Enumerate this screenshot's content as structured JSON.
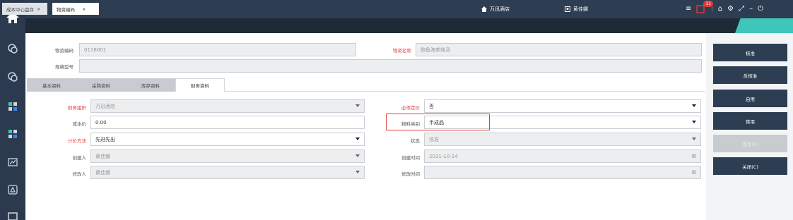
{
  "topbar": {
    "store": "万迅酒店",
    "user": "黄佳娜",
    "notification_count": "11"
  },
  "tabs": [
    {
      "label": "成本中心盘存"
    },
    {
      "label": "物资编码"
    }
  ],
  "header_fields": {
    "code_label": "物资编码",
    "code_value": "0118001",
    "name_label": "物资名称",
    "name_value": "鲍鱼海参炖汤",
    "spec_label": "规格型号",
    "spec_value": ""
  },
  "subtabs": [
    {
      "label": "基本资料"
    },
    {
      "label": "采购资料"
    },
    {
      "label": "库存资料"
    },
    {
      "label": "财务资料"
    }
  ],
  "form": {
    "org_label": "财务组织",
    "org_value": "万迅酒店",
    "cost_label": "成本价",
    "cost_value": "0.00",
    "method_label": "计价方法",
    "method_value": "先进先出",
    "creator_label": "创建人",
    "creator_value": "黄佳娜",
    "modifier_label": "修改人",
    "modifier_value": "黄佳娜",
    "must_price_label": "必须定价",
    "must_price_value": "否",
    "category_label": "物料类别",
    "category_value": "半成品",
    "status_label": "状态",
    "status_value": "核准",
    "created_time_label": "创建时间",
    "created_time_value": "2021-10-14",
    "modified_time_label": "修改时间",
    "modified_time_value": ""
  },
  "buttons": {
    "approve": "核准",
    "unapprove": "反核准",
    "enable": "启用",
    "disable": "禁用",
    "save": "保存(S)",
    "close": "关闭(C)"
  },
  "colors": {
    "rail": "#2b3a4e",
    "accent": "#3fc6bb",
    "required": "#e53935"
  }
}
